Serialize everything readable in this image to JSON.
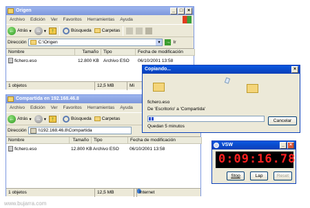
{
  "window1": {
    "title": "Origen",
    "menu": [
      "Archivo",
      "Edición",
      "Ver",
      "Favoritos",
      "Herramientas",
      "Ayuda"
    ],
    "toolbar": {
      "back": "Atrás",
      "search": "Búsqueda",
      "folders": "Carpetas"
    },
    "address_label": "Dirección",
    "address_value": "C:\\Origen",
    "go_label": "Ir",
    "columns": [
      "Nombre",
      "Tamaño",
      "Tipo",
      "Fecha de modificación"
    ],
    "rows": [
      {
        "name": "fichero.eso",
        "size": "12.800 KB",
        "type": "Archivo ESO",
        "date": "06/10/2001 13:58"
      }
    ],
    "status": {
      "objects": "1 objetos",
      "size": "12,5 MB",
      "zone": "Mi"
    }
  },
  "window2": {
    "title": "Compartida en 192.168.46.8",
    "menu": [
      "Archivo",
      "Edición",
      "Ver",
      "Favoritos",
      "Herramientas",
      "Ayuda"
    ],
    "toolbar": {
      "back": "Atrás",
      "search": "Búsqueda",
      "folders": "Carpetas"
    },
    "address_label": "Dirección",
    "address_value": "\\\\192.168.46.8\\Compartida",
    "go_label": "Ir",
    "columns": [
      "Nombre",
      "Tamaño",
      "Tipo",
      "Fecha de modificación"
    ],
    "rows": [
      {
        "name": "fichero.eso",
        "size": "12.800 KB",
        "type": "Archivo ESO",
        "date": "06/10/2001 13:58"
      }
    ],
    "status": {
      "objects": "1 objetos",
      "size": "12,5 MB",
      "zone": "Internet"
    }
  },
  "copy_dialog": {
    "title": "Copiando...",
    "filename": "fichero.eso",
    "from_to": "De 'Escritorio' a 'Compartida'",
    "remaining": "Quedan 5 minutos",
    "cancel": "Cancelar",
    "progress": 0.05
  },
  "stopwatch": {
    "title": "VSW",
    "time": "0:09:16.78",
    "buttons": [
      "Stop",
      "Lap",
      "Reset"
    ]
  },
  "watermark": "www.bujarra.com",
  "colors": {
    "title_active": "#0a4fd0",
    "title_inactive": "#7d97dc",
    "progress": "#2a4fd0",
    "lcd_text": "#ff2020"
  }
}
